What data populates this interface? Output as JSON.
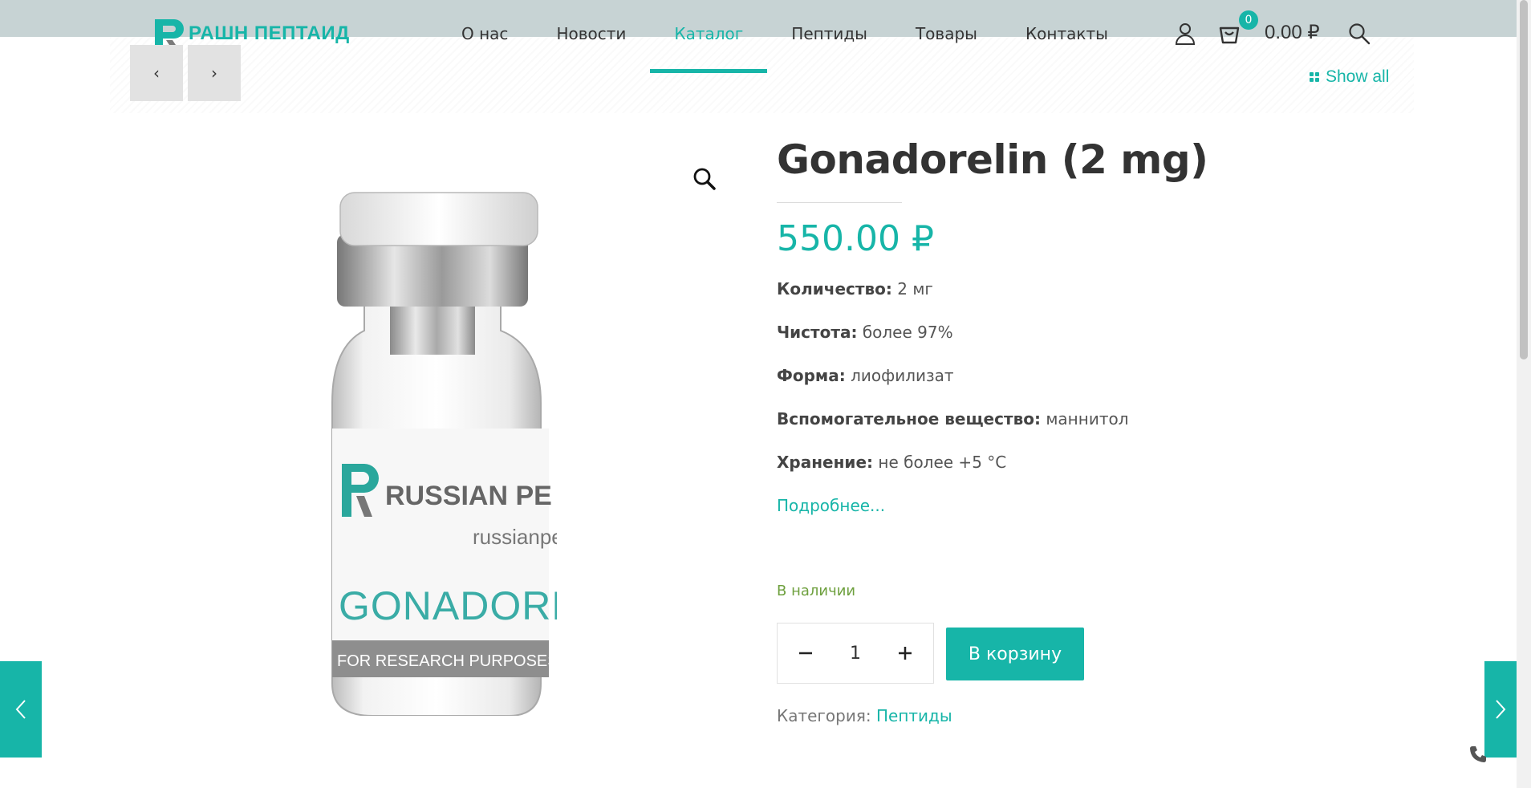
{
  "header": {
    "logo_text": "РАШН ПЕПТАИД",
    "nav": [
      {
        "label": "О нас"
      },
      {
        "label": "Новости"
      },
      {
        "label": "Каталог"
      },
      {
        "label": "Пептиды"
      },
      {
        "label": "Товары"
      },
      {
        "label": "Контакты"
      }
    ],
    "active_nav": "Каталог",
    "cart_count": "0",
    "cart_total": "0.00 ₽",
    "icons": [
      "user-icon",
      "cart-icon",
      "search-icon"
    ]
  },
  "pager": {
    "prev_symbol": "‹",
    "next_symbol": "›",
    "show_all_label": "Show all"
  },
  "product": {
    "title": "Gonadorelin (2 mg)",
    "price": "550.00 ₽",
    "specs": [
      {
        "label": "Количество:",
        "value": "2 мг"
      },
      {
        "label": "Чистота:",
        "value": "более 97%"
      },
      {
        "label": "Форма:",
        "value": "лиофилизат"
      },
      {
        "label": "Вспомогательное вещество:",
        "value": "маннитол"
      },
      {
        "label": "Хранение:",
        "value": "не более +5 °C"
      }
    ],
    "more_link": "Подробнее...",
    "stock": "В наличии",
    "quantity": "1",
    "add_to_cart": "В корзину",
    "category_label": "Категория:",
    "category_value": "Пептиды",
    "image_label": {
      "brand": "RUSSIAN PE",
      "site": "russianpe",
      "name": "GONADOREL",
      "footer": "FOR RESEARCH PURPOSES NOT"
    }
  },
  "colors": {
    "accent": "#17b5a8",
    "header_bg": "#c7d3d4",
    "stock": "#6ea03e"
  }
}
